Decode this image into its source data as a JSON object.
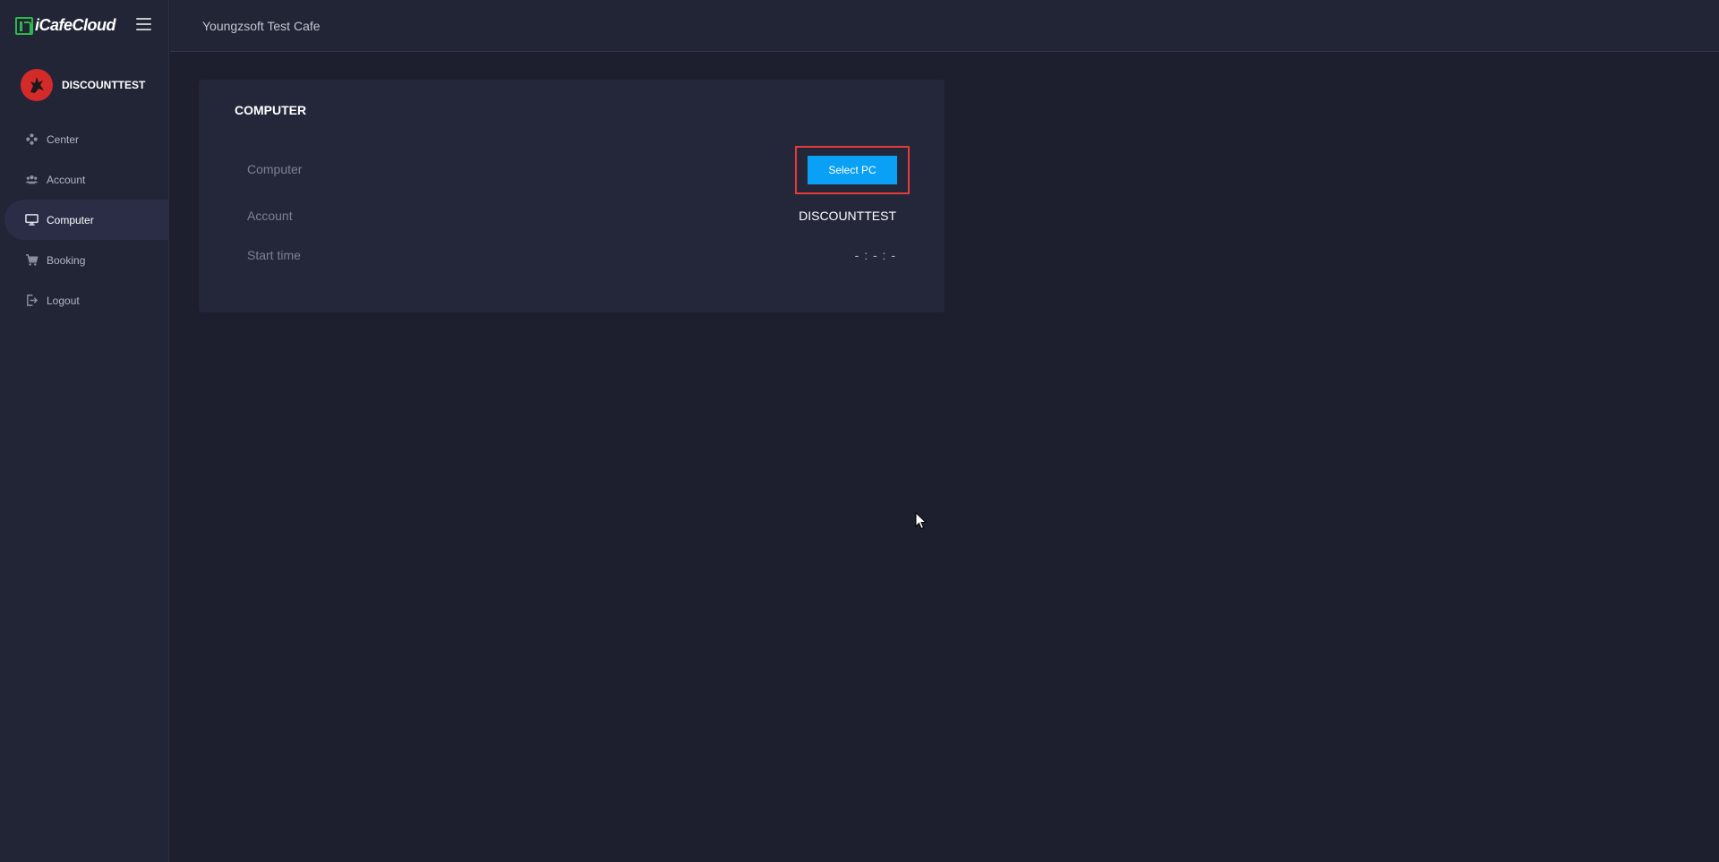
{
  "sidebar": {
    "logo_text": "iCafeCloud",
    "username": "DISCOUNTTEST",
    "items": [
      {
        "label": "Center",
        "icon": "gamepad-icon",
        "active": false
      },
      {
        "label": "Account",
        "icon": "users-icon",
        "active": false
      },
      {
        "label": "Computer",
        "icon": "monitor-icon",
        "active": true
      },
      {
        "label": "Booking",
        "icon": "cart-icon",
        "active": false
      },
      {
        "label": "Logout",
        "icon": "logout-icon",
        "active": false
      }
    ]
  },
  "header": {
    "title": "Youngzsoft Test Cafe"
  },
  "card": {
    "title": "COMPUTER",
    "rows": [
      {
        "label": "Computer",
        "button_label": "Select PC"
      },
      {
        "label": "Account",
        "value": "DISCOUNTTEST"
      },
      {
        "label": "Start time",
        "value": "- : - : -"
      }
    ]
  },
  "colors": {
    "background": "#1d1f2f",
    "sidebar": "#222536",
    "card": "#24273a",
    "accent_button": "#0aa0f5",
    "highlight_border": "#e53b3b",
    "logo_green": "#2eb84b",
    "avatar_red": "#d42a2a"
  }
}
